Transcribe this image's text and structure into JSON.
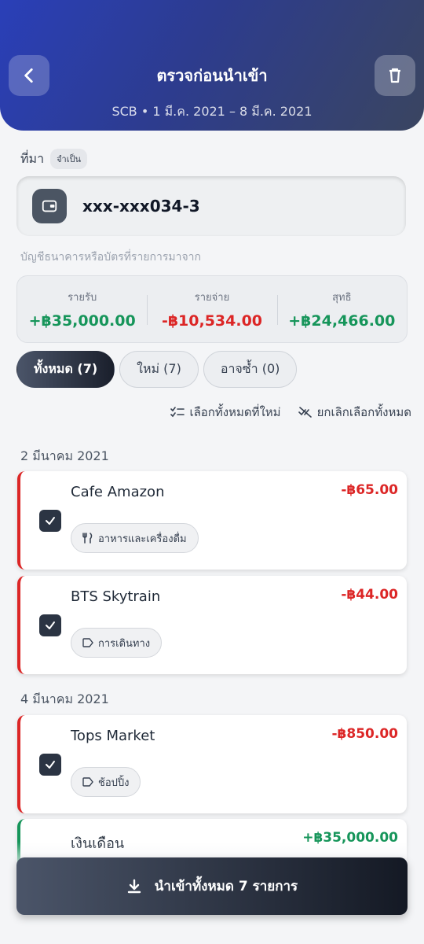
{
  "header": {
    "title": "ตรวจก่อนนำเข้า",
    "subtitle": "SCB • 1 มี.ค. 2021 – 8 มี.ค. 2021"
  },
  "source": {
    "label": "ที่มา",
    "required_badge": "จำเป็น",
    "account_number": "xxx-xxx034-3",
    "hint": "บัญชีธนาคารหรือบัตรที่รายการมาจาก"
  },
  "summary": {
    "income_label": "รายรับ",
    "income_value": "+฿35,000.00",
    "expense_label": "รายจ่าย",
    "expense_value": "-฿10,534.00",
    "net_label": "สุทธิ",
    "net_value": "+฿24,466.00"
  },
  "tabs": [
    {
      "label": "ทั้งหมด (7)",
      "active": true
    },
    {
      "label": "ใหม่ (7)",
      "active": false
    },
    {
      "label": "อาจซ้ำ (0)",
      "active": false
    }
  ],
  "actions": {
    "select_all_new": "เลือกทั้งหมดที่ใหม่",
    "deselect_all": "ยกเลิกเลือกทั้งหมด"
  },
  "groups": [
    {
      "date": "2 มีนาคม 2021",
      "items": [
        {
          "title": "Cafe Amazon",
          "amount": "-฿65.00",
          "category": "อาหารและเครื่องดื่ม",
          "category_icon": "utensils-icon",
          "checked": true
        },
        {
          "title": "BTS Skytrain",
          "amount": "-฿44.00",
          "category": "การเดินทาง",
          "category_icon": "tag-icon",
          "checked": true
        }
      ]
    },
    {
      "date": "4 มีนาคม 2021",
      "items": [
        {
          "title": "Tops Market",
          "amount": "-฿850.00",
          "category": "ช้อปปิ้ง",
          "category_icon": "tag-icon",
          "checked": true
        },
        {
          "title": "เงินเดือน",
          "amount": "+฿35,000.00"
        }
      ]
    }
  ],
  "import_button": {
    "label": "นำเข้าทั้งหมด 7 รายการ"
  },
  "colors": {
    "income": "#16955a",
    "expense": "#dc2626",
    "dark": "#1a1f2c"
  }
}
